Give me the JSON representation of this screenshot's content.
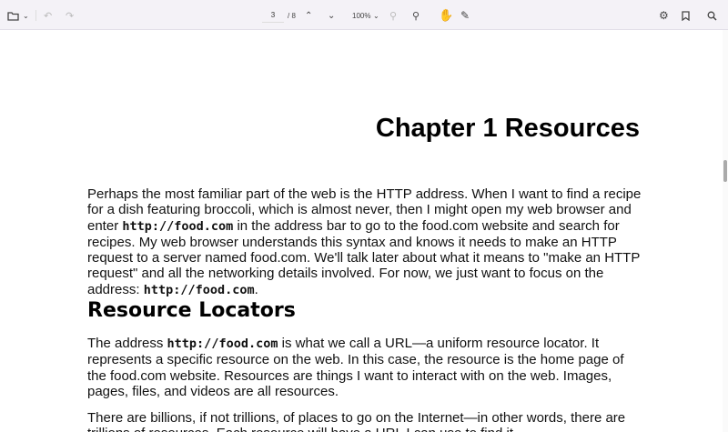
{
  "toolbar": {
    "current_page": "3",
    "total_pages": "/ 8",
    "zoom": "100%"
  },
  "document": {
    "title": "Chapter 1 Resources",
    "p1": {
      "a": "Perhaps the most familiar part of the web is the HTTP address. When I want to find a recipe for a dish featuring broccoli, which is almost never, then I might open my web browser and enter ",
      "code1": "http://food.com",
      "b": " in the address bar to go to the food.com website and search for recipes. My web browser understands this syntax and knows it needs to make an HTTP request to a server named food.com. We'll talk later about what it means to \"make an HTTP request\" and all the networking details involved. For now, we just want to focus on the address: ",
      "code2": "http://food.com",
      "c": "."
    },
    "h2": "Resource Locators",
    "p2": {
      "a": "The address ",
      "code": "http://food.com",
      "b": "  is what we call a URL—a uniform resource locator. It represents a specific resource on the web. In this case, the resource is the home page of the food.com website. Resources are things I want to interact with on the web. Images, pages, files, and videos are all resources."
    },
    "p3": "There are billions, if not trillions, of places to go on the Internet—in other words, there are trillions of resources. Each resource will have a URL I can use to find it."
  }
}
